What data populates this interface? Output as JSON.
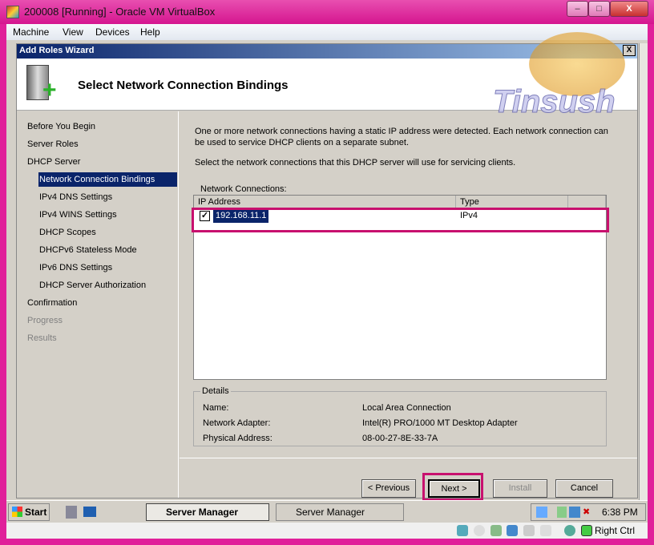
{
  "window": {
    "title": "200008 [Running] - Oracle VM VirtualBox",
    "min": "–",
    "max": "□",
    "close": "X"
  },
  "menu": [
    "Machine",
    "View",
    "Devices",
    "Help"
  ],
  "wizard": {
    "title": "Add Roles Wizard",
    "close": "X",
    "heading": "Select Network Connection Bindings",
    "nav": [
      {
        "label": "Before You Begin",
        "level": 0,
        "state": "normal"
      },
      {
        "label": "Server Roles",
        "level": 0,
        "state": "normal"
      },
      {
        "label": "DHCP Server",
        "level": 0,
        "state": "normal"
      },
      {
        "label": "Network Connection Bindings",
        "level": 1,
        "state": "selected"
      },
      {
        "label": "IPv4 DNS Settings",
        "level": 1,
        "state": "normal"
      },
      {
        "label": "IPv4 WINS Settings",
        "level": 1,
        "state": "normal"
      },
      {
        "label": "DHCP Scopes",
        "level": 1,
        "state": "normal"
      },
      {
        "label": "DHCPv6 Stateless Mode",
        "level": 1,
        "state": "normal"
      },
      {
        "label": "IPv6 DNS Settings",
        "level": 1,
        "state": "normal"
      },
      {
        "label": "DHCP Server Authorization",
        "level": 1,
        "state": "normal"
      },
      {
        "label": "Confirmation",
        "level": 0,
        "state": "normal"
      },
      {
        "label": "Progress",
        "level": 0,
        "state": "disabled"
      },
      {
        "label": "Results",
        "level": 0,
        "state": "disabled"
      }
    ],
    "intro": "One or more network connections having a static IP address were detected. Each network connection can be used to service DHCP clients on a separate subnet.",
    "instruction": "Select the network connections that this DHCP server will use for servicing clients.",
    "list_label": "Network Connections:",
    "columns": [
      "IP Address",
      "Type"
    ],
    "rows": [
      {
        "ip": "192.168.11.1",
        "type": "IPv4",
        "checked": true
      }
    ],
    "details": {
      "title": "Details",
      "items": [
        {
          "label": "Name:",
          "value": "Local Area Connection"
        },
        {
          "label": "Network Adapter:",
          "value": "Intel(R) PRO/1000 MT Desktop Adapter"
        },
        {
          "label": "Physical Address:",
          "value": "08-00-27-8E-33-7A"
        }
      ]
    },
    "buttons": {
      "previous": "< Previous",
      "next": "Next >",
      "install": "Install",
      "cancel": "Cancel"
    }
  },
  "taskbar": {
    "start": "Start",
    "tasks": [
      "Server Manager",
      "Server Manager"
    ],
    "clock": "6:38 PM"
  },
  "status": {
    "host_key": "Right Ctrl"
  },
  "watermark": "Tinsush",
  "highlight_color": "#c8106e"
}
